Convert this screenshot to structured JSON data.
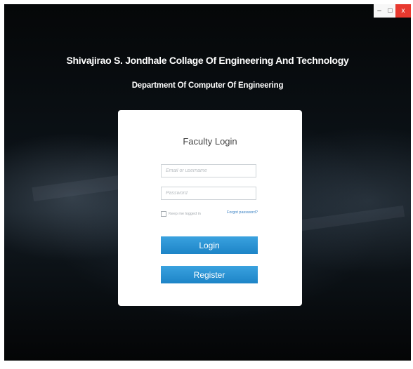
{
  "window": {
    "controls": {
      "minimize": "–",
      "maximize": "□",
      "close": "x"
    },
    "accent_close": "#e8392f"
  },
  "header": {
    "title": "Shivajirao S. Jondhale Collage Of Engineering And Technology",
    "subtitle": "Department Of Computer Of Engineering"
  },
  "login": {
    "heading": "Faculty Login",
    "email_placeholder": "Email or username",
    "password_placeholder": "Password",
    "remember_label": "Keep me logged in",
    "remember_checked": false,
    "forgot_label": "Forgot password?",
    "login_label": "Login",
    "register_label": "Register",
    "accent": "#2a93d5"
  }
}
